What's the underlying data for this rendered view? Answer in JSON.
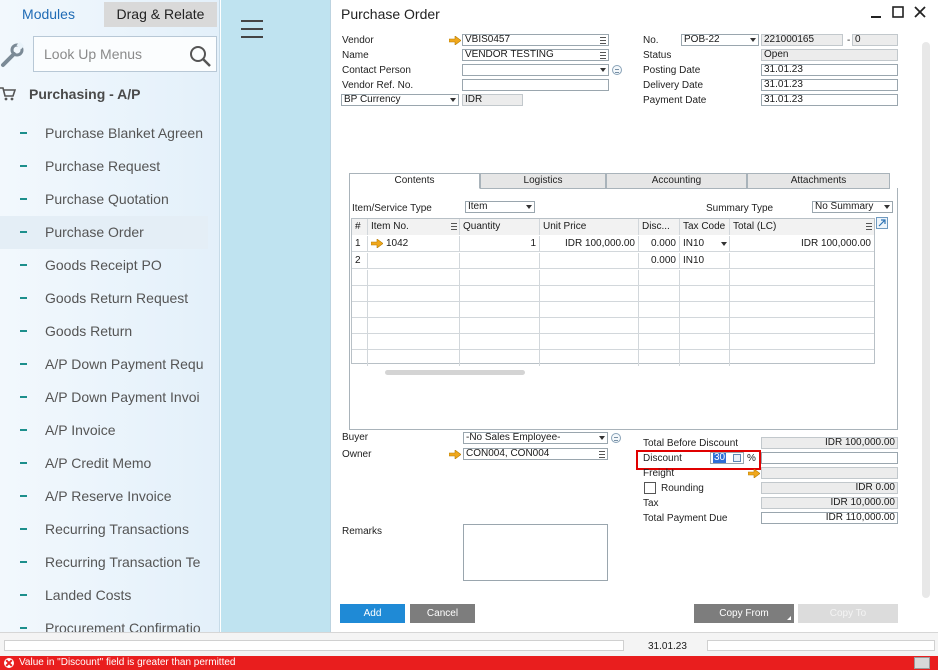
{
  "nav": {
    "tab_modules": "Modules",
    "tab_drag_relate": "Drag & Relate",
    "lookup_placeholder": "Look Up Menus",
    "module_title": "Purchasing - A/P",
    "items": [
      {
        "label": "Purchase Blanket Agreen"
      },
      {
        "label": "Purchase Request"
      },
      {
        "label": "Purchase Quotation"
      },
      {
        "label": "Purchase Order"
      },
      {
        "label": "Goods Receipt PO"
      },
      {
        "label": "Goods Return Request"
      },
      {
        "label": "Goods Return"
      },
      {
        "label": "A/P Down Payment Requ"
      },
      {
        "label": "A/P Down Payment Invoi"
      },
      {
        "label": "A/P Invoice"
      },
      {
        "label": "A/P Credit Memo"
      },
      {
        "label": "A/P Reserve Invoice"
      },
      {
        "label": "Recurring Transactions"
      },
      {
        "label": "Recurring Transaction Te"
      },
      {
        "label": "Landed Costs"
      },
      {
        "label": "Procurement Confirmatio"
      }
    ]
  },
  "window": {
    "title": "Purchase Order"
  },
  "header": {
    "vendor_label": "Vendor",
    "vendor_value": "VBIS0457",
    "name_label": "Name",
    "name_value": "VENDOR TESTING",
    "contact_label": "Contact Person",
    "contact_value": "",
    "vendor_ref_label": "Vendor Ref. No.",
    "vendor_ref_value": "",
    "currency_type": "BP Currency",
    "currency_value": "IDR",
    "no_label": "No.",
    "series": "POB-22",
    "doc_number": "221000165",
    "doc_suffix_sep": "-",
    "doc_suffix": "0",
    "status_label": "Status",
    "status_value": "Open",
    "posting_label": "Posting Date",
    "posting_value": "31.01.23",
    "delivery_label": "Delivery Date",
    "delivery_value": "31.01.23",
    "payment_label": "Payment Date",
    "payment_value": "31.01.23"
  },
  "doc_tabs": [
    "Contents",
    "Logistics",
    "Accounting",
    "Attachments"
  ],
  "contents": {
    "item_service_label": "Item/Service Type",
    "item_service_value": "Item",
    "summary_label": "Summary Type",
    "summary_value": "No Summary",
    "columns": [
      "#",
      "Item No.",
      "Quantity",
      "Unit Price",
      "Disc...",
      "Tax Code",
      "Total (LC)"
    ],
    "rows": [
      {
        "num": "1",
        "item": "1042",
        "qty": "1",
        "price": "IDR 100,000.00",
        "disc": "0.000",
        "tax": "IN10",
        "total": "IDR 100,000.00"
      },
      {
        "num": "2",
        "item": "",
        "qty": "",
        "price": "",
        "disc": "0.000",
        "tax": "IN10",
        "total": ""
      }
    ]
  },
  "footer": {
    "buyer_label": "Buyer",
    "buyer_value": "-No Sales Employee-",
    "owner_label": "Owner",
    "owner_value": "CON004, CON004",
    "remarks_label": "Remarks",
    "total_before_label": "Total Before Discount",
    "total_before_value": "IDR 100,000.00",
    "discount_label": "Discount",
    "discount_value": "30",
    "discount_pct": "%",
    "freight_label": "Freight",
    "rounding_label": "Rounding",
    "rounding_value": "IDR 0.00",
    "tax_label": "Tax",
    "tax_value": "IDR 10,000.00",
    "total_due_label": "Total Payment Due",
    "total_due_value": "IDR 110,000.00"
  },
  "buttons": {
    "add": "Add",
    "cancel": "Cancel",
    "copy_from": "Copy From",
    "copy_to": "Copy To"
  },
  "statusbar": {
    "date": "31.01.23",
    "error_message": "Value in \"Discount\" field is greater than permitted"
  },
  "colors": {
    "accent_blue": "#1f8ad6",
    "error_red": "#e91e1e",
    "highlight_red": "#e00000"
  }
}
